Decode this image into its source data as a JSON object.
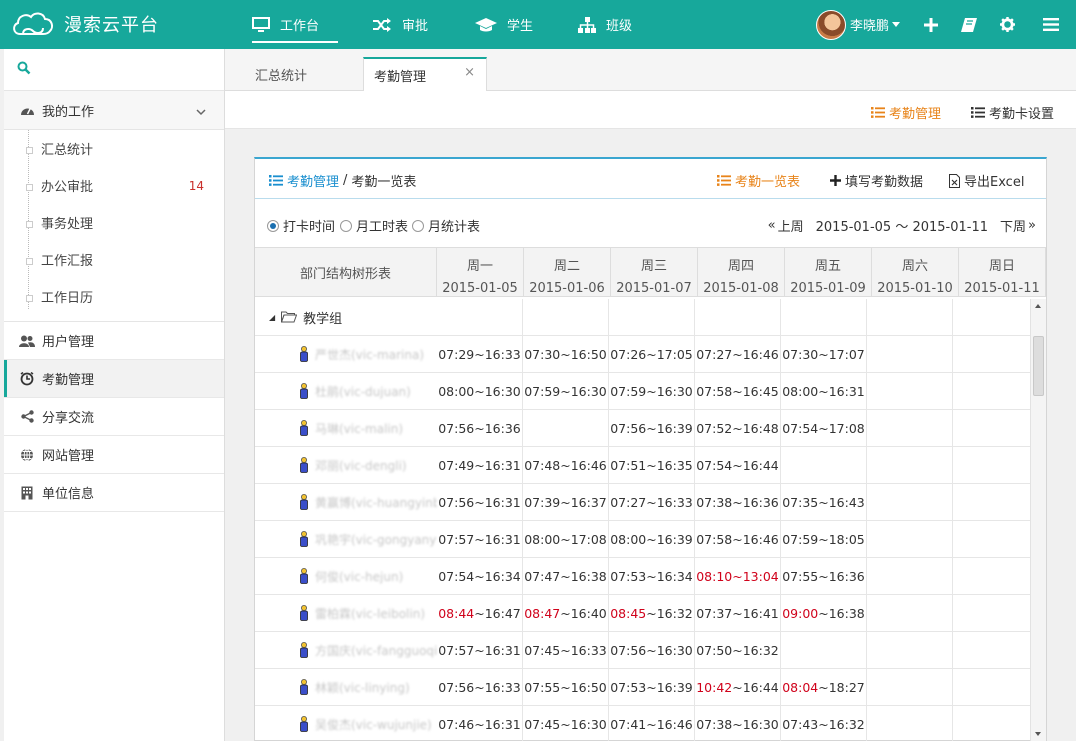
{
  "app": {
    "title": "漫索云平台"
  },
  "nav": [
    {
      "label": "工作台",
      "icon": "monitor-icon"
    },
    {
      "label": "审批",
      "icon": "shuffle-icon"
    },
    {
      "label": "学生",
      "icon": "graduation-cap-icon"
    },
    {
      "label": "班级",
      "icon": "sitemap-icon"
    }
  ],
  "user": {
    "name": "李晓鹏"
  },
  "sidebar": {
    "work_group": "我的工作",
    "work_items": [
      {
        "label": "汇总统计",
        "badge": ""
      },
      {
        "label": "办公审批",
        "badge": "14"
      },
      {
        "label": "事务处理",
        "badge": ""
      },
      {
        "label": "工作汇报",
        "badge": ""
      },
      {
        "label": "工作日历",
        "badge": ""
      }
    ],
    "items": [
      {
        "label": "用户管理",
        "icon": "users-icon"
      },
      {
        "label": "考勤管理",
        "icon": "clock-icon"
      },
      {
        "label": "分享交流",
        "icon": "share-icon"
      },
      {
        "label": "网站管理",
        "icon": "globe-icon"
      },
      {
        "label": "单位信息",
        "icon": "building-icon"
      }
    ]
  },
  "tabs": [
    {
      "label": "汇总统计"
    },
    {
      "label": "考勤管理",
      "close": "×"
    }
  ],
  "subtoolbar": {
    "attendance": "考勤管理",
    "card_settings": "考勤卡设置"
  },
  "panel": {
    "crumb_link": "考勤管理",
    "crumb_sep": "/",
    "crumb_current": "考勤一览表",
    "btn_overview": "考勤一览表",
    "btn_fill": "填写考勤数据",
    "btn_export": "导出Excel",
    "radios": [
      "打卡时间",
      "月工时表",
      "月统计表"
    ],
    "prev_week": "上周",
    "date_range": "2015-01-05 ～ 2015-01-11",
    "next_week": "下周",
    "tree_header": "部门结构树形表",
    "days": [
      {
        "name": "周一",
        "date": "2015-01-05"
      },
      {
        "name": "周二",
        "date": "2015-01-06"
      },
      {
        "name": "周三",
        "date": "2015-01-07"
      },
      {
        "name": "周四",
        "date": "2015-01-08"
      },
      {
        "name": "周五",
        "date": "2015-01-09"
      },
      {
        "name": "周六",
        "date": "2015-01-10"
      },
      {
        "name": "周日",
        "date": "2015-01-11"
      }
    ],
    "group": "教学组",
    "rows": [
      {
        "name": "严世杰(vic-marina)",
        "times": [
          [
            "07:29",
            "16:33"
          ],
          [
            "07:30",
            "16:50"
          ],
          [
            "07:26",
            "17:05"
          ],
          [
            "07:27",
            "16:46"
          ],
          [
            "07:30",
            "17:07"
          ],
          null,
          null
        ],
        "late": [
          [
            0,
            0
          ],
          [
            0,
            0
          ],
          [
            0,
            0
          ],
          [
            0,
            0
          ],
          [
            0,
            0
          ],
          null,
          null
        ]
      },
      {
        "name": "杜鹃(vic-dujuan)",
        "times": [
          [
            "08:00",
            "16:30"
          ],
          [
            "07:59",
            "16:30"
          ],
          [
            "07:59",
            "16:30"
          ],
          [
            "07:58",
            "16:45"
          ],
          [
            "08:00",
            "16:31"
          ],
          null,
          null
        ],
        "late": [
          [
            0,
            0
          ],
          [
            0,
            0
          ],
          [
            0,
            0
          ],
          [
            0,
            0
          ],
          [
            0,
            0
          ],
          null,
          null
        ]
      },
      {
        "name": "马琳(vic-malin)",
        "times": [
          [
            "07:56",
            "16:36"
          ],
          null,
          [
            "07:56",
            "16:39"
          ],
          [
            "07:52",
            "16:48"
          ],
          [
            "07:54",
            "17:08"
          ],
          null,
          null
        ],
        "late": [
          [
            0,
            0
          ],
          null,
          [
            0,
            0
          ],
          [
            0,
            0
          ],
          [
            0,
            0
          ],
          null,
          null
        ]
      },
      {
        "name": "邓丽(vic-dengli)",
        "times": [
          [
            "07:49",
            "16:31"
          ],
          [
            "07:48",
            "16:46"
          ],
          [
            "07:51",
            "16:35"
          ],
          [
            "07:54",
            "16:44"
          ],
          null,
          null,
          null
        ],
        "late": [
          [
            0,
            0
          ],
          [
            0,
            0
          ],
          [
            0,
            0
          ],
          [
            0,
            0
          ],
          null,
          null,
          null
        ]
      },
      {
        "name": "黄赢博(vic-huangyinbo)",
        "times": [
          [
            "07:56",
            "16:31"
          ],
          [
            "07:39",
            "16:37"
          ],
          [
            "07:27",
            "16:33"
          ],
          [
            "07:38",
            "16:36"
          ],
          [
            "07:35",
            "16:43"
          ],
          null,
          null
        ],
        "late": [
          [
            0,
            0
          ],
          [
            0,
            0
          ],
          [
            0,
            0
          ],
          [
            0,
            0
          ],
          [
            0,
            0
          ],
          null,
          null
        ]
      },
      {
        "name": "巩艳宇(vic-gongyanyu)",
        "times": [
          [
            "07:57",
            "16:31"
          ],
          [
            "08:00",
            "17:08"
          ],
          [
            "08:00",
            "16:39"
          ],
          [
            "07:58",
            "16:46"
          ],
          [
            "07:59",
            "18:05"
          ],
          null,
          null
        ],
        "late": [
          [
            0,
            0
          ],
          [
            0,
            0
          ],
          [
            0,
            0
          ],
          [
            0,
            0
          ],
          [
            0,
            0
          ],
          null,
          null
        ]
      },
      {
        "name": "何俊(vic-hejun)",
        "times": [
          [
            "07:54",
            "16:34"
          ],
          [
            "07:47",
            "16:38"
          ],
          [
            "07:53",
            "16:34"
          ],
          [
            "08:10",
            "13:04"
          ],
          [
            "07:55",
            "16:36"
          ],
          null,
          null
        ],
        "late": [
          [
            0,
            0
          ],
          [
            0,
            0
          ],
          [
            0,
            0
          ],
          [
            1,
            1
          ],
          [
            0,
            0
          ],
          null,
          null
        ]
      },
      {
        "name": "雷柏霖(vic-leibolin)",
        "times": [
          [
            "08:44",
            "16:47"
          ],
          [
            "08:47",
            "16:40"
          ],
          [
            "08:45",
            "16:32"
          ],
          [
            "07:37",
            "16:41"
          ],
          [
            "09:00",
            "16:38"
          ],
          null,
          null
        ],
        "late": [
          [
            1,
            0
          ],
          [
            1,
            0
          ],
          [
            1,
            0
          ],
          [
            0,
            0
          ],
          [
            1,
            0
          ],
          null,
          null
        ]
      },
      {
        "name": "方国庆(vic-fangguoqing)",
        "times": [
          [
            "07:57",
            "16:31"
          ],
          [
            "07:45",
            "16:33"
          ],
          [
            "07:56",
            "16:30"
          ],
          [
            "07:50",
            "16:32"
          ],
          null,
          null,
          null
        ],
        "late": [
          [
            0,
            0
          ],
          [
            0,
            0
          ],
          [
            0,
            0
          ],
          [
            0,
            0
          ],
          null,
          null,
          null
        ]
      },
      {
        "name": "林颖(vic-linying)",
        "times": [
          [
            "07:56",
            "16:33"
          ],
          [
            "07:55",
            "16:50"
          ],
          [
            "07:53",
            "16:39"
          ],
          [
            "10:42",
            "16:44"
          ],
          [
            "08:04",
            "18:27"
          ],
          null,
          null
        ],
        "late": [
          [
            0,
            0
          ],
          [
            0,
            0
          ],
          [
            0,
            0
          ],
          [
            1,
            0
          ],
          [
            1,
            0
          ],
          null,
          null
        ]
      },
      {
        "name": "吴俊杰(vic-wujunjie)",
        "times": [
          [
            "07:46",
            "16:31"
          ],
          [
            "07:45",
            "16:30"
          ],
          [
            "07:41",
            "16:46"
          ],
          [
            "07:38",
            "16:30"
          ],
          [
            "07:43",
            "16:32"
          ],
          null,
          null
        ],
        "late": [
          [
            0,
            0
          ],
          [
            0,
            0
          ],
          [
            0,
            0
          ],
          [
            0,
            0
          ],
          [
            0,
            0
          ],
          null,
          null
        ]
      }
    ]
  },
  "colors": {
    "brand": "#17a89b",
    "link": "#1a8fcf",
    "accent": "#e8841a",
    "late": "#d0021b"
  }
}
